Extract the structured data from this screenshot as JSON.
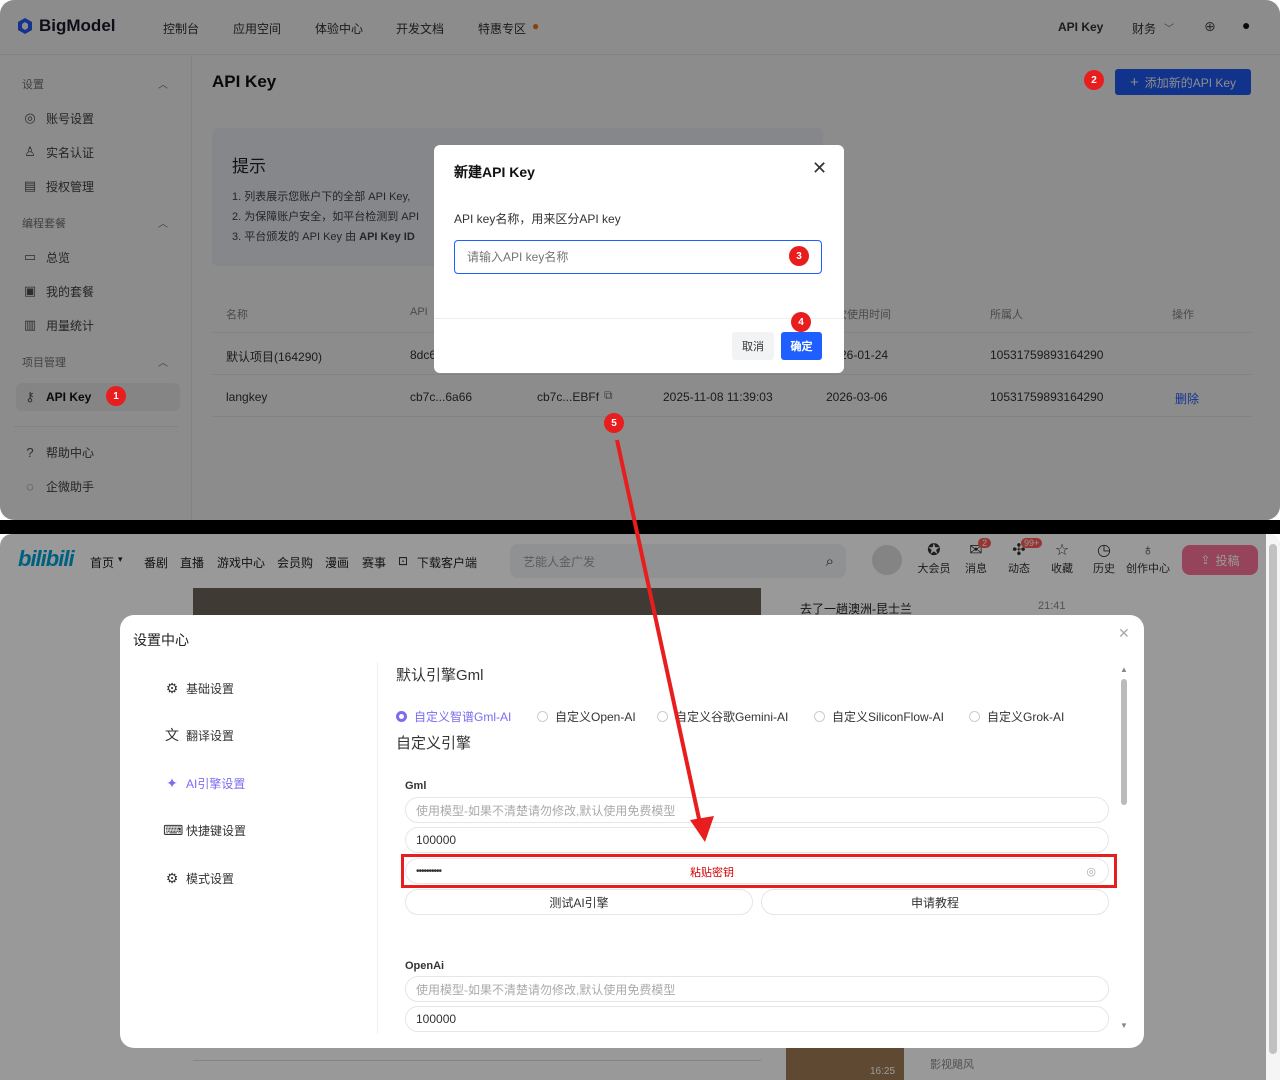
{
  "bigmodel": {
    "logo": "BigModel",
    "nav": [
      "控制台",
      "应用空间",
      "体验中心",
      "开发文档",
      "特惠专区"
    ],
    "nav_right": {
      "api_key": "API Key",
      "finance": "财务"
    },
    "sidebar": {
      "sec_settings": "设置",
      "account": "账号设置",
      "realname": "实名认证",
      "auth": "授权管理",
      "sec_coding": "编程套餐",
      "overview": "总览",
      "my_plan": "我的套餐",
      "usage": "用量统计",
      "sec_project": "项目管理",
      "api_key": "API Key",
      "help": "帮助中心",
      "assistant": "企微助手"
    },
    "page_title": "API Key",
    "add_button": "添加新的API Key",
    "tip": {
      "title": "提示",
      "line1": "1. 列表展示您账户下的全部 API Key,",
      "line2": "2. 为保障账户安全，如平台检测到 API",
      "line3_pre": "3. 平台颁发的 API Key 由 ",
      "line3_bold": "API Key ID"
    },
    "table": {
      "headers": [
        "名称",
        "API",
        "",
        "",
        "次使用时间",
        "所属人",
        "操作"
      ],
      "rows": [
        {
          "name": "默认项目(164290)",
          "api": "8dc6",
          "secret": "",
          "created": "",
          "last": "26-01-24",
          "owner": "10531759893164290",
          "op": ""
        },
        {
          "name": "langkey",
          "api": "cb7c...6a66",
          "secret": "cb7c...EBFf",
          "created": "2025-11-08 11:39:03",
          "last": "2026-03-06",
          "owner": "10531759893164290",
          "op": "删除"
        }
      ]
    },
    "modal": {
      "title": "新建API Key",
      "label": "API key名称，用来区分API key",
      "placeholder": "请输入API key名称",
      "cancel": "取消",
      "confirm": "确定"
    },
    "markers": [
      "1",
      "2",
      "3",
      "4",
      "5"
    ]
  },
  "bilibili": {
    "logo": "bilibili",
    "nav": [
      "首页",
      "番剧",
      "直播",
      "游戏中心",
      "会员购",
      "漫画",
      "赛事",
      "下载客户端"
    ],
    "search_placeholder": "艺能人金广发",
    "icons": [
      {
        "label": "大会员",
        "glyph": "✪"
      },
      {
        "label": "消息",
        "glyph": "✉",
        "badge": "2"
      },
      {
        "label": "动态",
        "glyph": "✣",
        "badge": "99+"
      },
      {
        "label": "收藏",
        "glyph": "☆"
      },
      {
        "label": "历史",
        "glyph": "◷"
      },
      {
        "label": "创作中心",
        "glyph": "♁"
      }
    ],
    "upload": "投稿",
    "bg_video_title": "去了一趟澳洲-昆士兰",
    "bg_video_time": "21:41",
    "bg_bottom_channel": "影视飓风",
    "bg_bottom_time": "16:25",
    "settings": {
      "title": "设置中心",
      "menu": [
        {
          "label": "基础设置",
          "icon": "gear-icon",
          "glyph": "⚙"
        },
        {
          "label": "翻译设置",
          "icon": "translate-icon",
          "glyph": "文"
        },
        {
          "label": "AI引擎设置",
          "icon": "sparkle-icon",
          "glyph": "✦",
          "active": true
        },
        {
          "label": "快捷键设置",
          "icon": "keyboard-icon",
          "glyph": "⌨"
        },
        {
          "label": "模式设置",
          "icon": "gear-icon",
          "glyph": "⚙"
        }
      ],
      "default_engine": "默认引擎Gml",
      "engines": [
        "自定义智谱Gml-AI",
        "自定义Open-AI",
        "自定义谷歌Gemini-AI",
        "自定义SiliconFlow-AI",
        "自定义Grok-AI"
      ],
      "custom_engine": "自定义引擎",
      "gml_label": "Gml",
      "model_placeholder": "使用模型-如果不清楚请勿修改,默认使用免费模型",
      "max_value": "100000",
      "key_value": "••••••••••",
      "paste_key": "粘贴密钥",
      "test_button": "测试AI引擎",
      "tutorial_button": "申请教程",
      "openai_label": "OpenAi",
      "openai_placeholder": "使用模型-如果不清楚请勿修改,默认使用免费模型",
      "openai_max": "100000"
    }
  },
  "colors": {
    "primary": "#1f5eff",
    "red": "#e81e1e",
    "purple": "#7b6cf0",
    "bili_blue": "#00a1d6",
    "bili_pink": "#fb7299"
  }
}
